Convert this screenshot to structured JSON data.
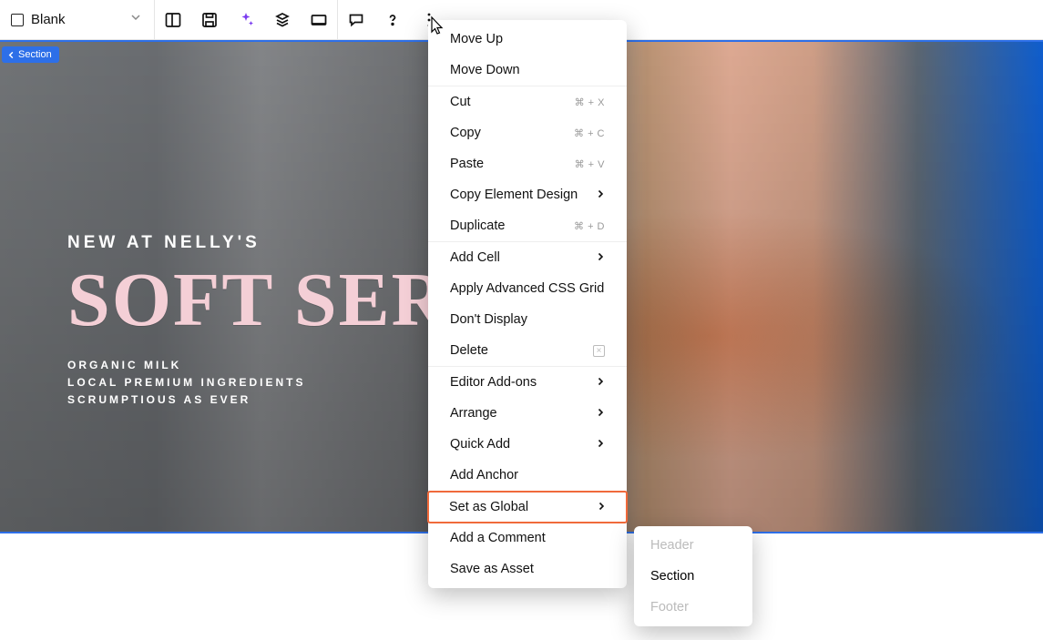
{
  "toolbar": {
    "blank_label": "Blank"
  },
  "section_pill": {
    "label": "Section"
  },
  "hero": {
    "eyebrow": "NEW AT NELLY'S",
    "headline": "SOFT SERVE",
    "line1": "ORGANIC MILK",
    "line2": "LOCAL PREMIUM INGREDIENTS",
    "line3": "SCRUMPTIOUS AS EVER"
  },
  "menu": {
    "move_up": "Move Up",
    "move_down": "Move Down",
    "cut": "Cut",
    "cut_sc": "⌘ + X",
    "copy": "Copy",
    "copy_sc": "⌘ + C",
    "paste": "Paste",
    "paste_sc": "⌘ + V",
    "copy_element_design": "Copy Element Design",
    "duplicate": "Duplicate",
    "duplicate_sc": "⌘ + D",
    "add_cell": "Add Cell",
    "apply_css_grid": "Apply Advanced CSS Grid",
    "dont_display": "Don't Display",
    "delete": "Delete",
    "editor_addons": "Editor Add-ons",
    "arrange": "Arrange",
    "quick_add": "Quick Add",
    "add_anchor": "Add Anchor",
    "set_as_global": "Set as Global",
    "add_comment": "Add a Comment",
    "save_as_asset": "Save as Asset"
  },
  "submenu": {
    "header": "Header",
    "section": "Section",
    "footer": "Footer"
  }
}
